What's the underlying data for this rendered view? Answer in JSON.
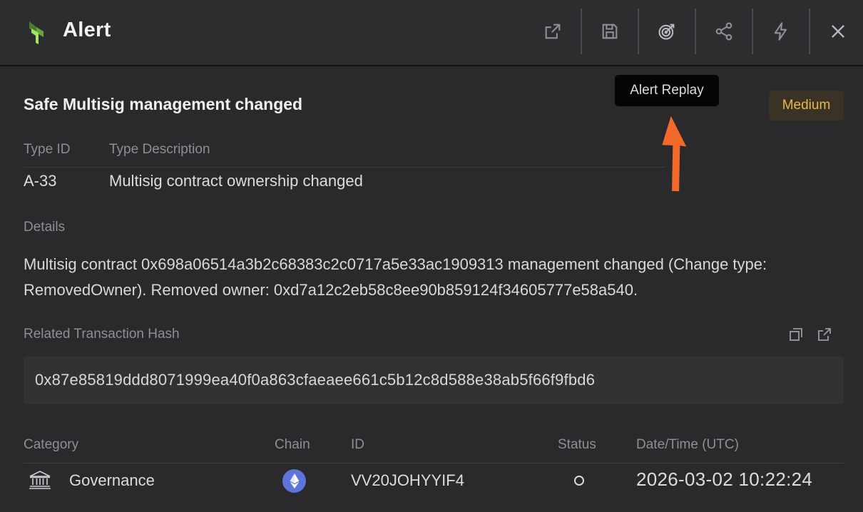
{
  "header": {
    "title": "Alert",
    "buttons": [
      {
        "name": "open-external-icon"
      },
      {
        "name": "save-icon"
      },
      {
        "name": "target-icon"
      },
      {
        "name": "share-icon"
      },
      {
        "name": "lightning-icon"
      },
      {
        "name": "close-icon"
      }
    ]
  },
  "alert": {
    "name": "Safe Multisig management changed",
    "severity": "Medium",
    "severity_color": "#e8b84a",
    "tooltip": "Alert Replay",
    "type_id_label": "Type ID",
    "type_desc_label": "Type Description",
    "type_id": "A-33",
    "type_desc": "Multisig contract ownership changed",
    "details_label": "Details",
    "details": "Multisig contract 0x698a06514a3b2c68383c2c0717a5e33ac1909313 management changed (Change type: RemovedOwner). Removed owner: 0xd7a12c2eb58c8ee90b859124f34605777e58a540.",
    "hash_label": "Related Transaction Hash",
    "hash": "0x87e85819ddd8071999ea40f0a863cfaeaee661c5b12c8d588e38ab5f66f9fbd6"
  },
  "table": {
    "headers": {
      "category": "Category",
      "chain": "Chain",
      "id": "ID",
      "status": "Status",
      "datetime": "Date/Time (UTC)"
    },
    "row": {
      "category": "Governance",
      "category_icon": "bank-icon",
      "chain_icon": "ethereum-icon",
      "id": "VV20JOHYYIF4",
      "status_icon": "circle-icon",
      "datetime": "2026-03-02 10:22:24"
    }
  },
  "colors": {
    "accent_green": "#a7e26a",
    "arrow": "#f2692a",
    "ethereum": "#5d74d9"
  }
}
